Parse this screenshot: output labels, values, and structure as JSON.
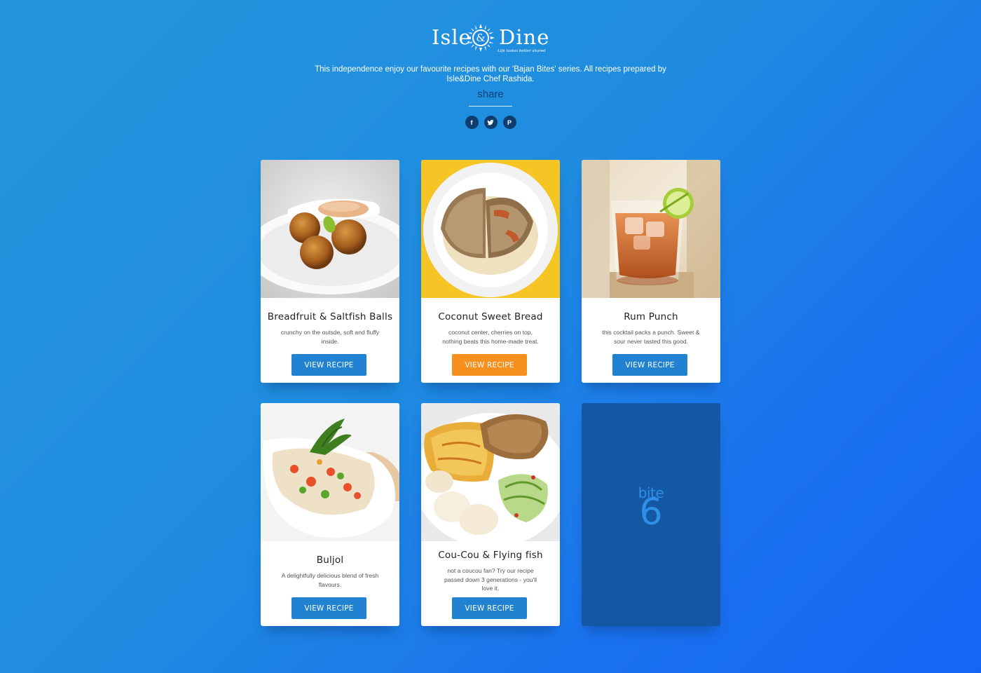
{
  "brand": {
    "name_left": "Isle",
    "name_right": "Dine",
    "ampersand": "&",
    "tagline": "Life tastes better shared"
  },
  "intro": {
    "text": "This independence enjoy our favourite recipes with our 'Bajan Bites' series. All recipes prepared by Isle&Dine Chef Rashida."
  },
  "share": {
    "label": "share",
    "buttons": [
      {
        "icon": "facebook-icon",
        "glyph": "f"
      },
      {
        "icon": "twitter-icon",
        "glyph": ""
      },
      {
        "icon": "pinterest-icon",
        "glyph": "P"
      }
    ]
  },
  "colors": {
    "button_blue": "#2182d2",
    "button_orange": "#f7901e",
    "share_text": "#0f3f78",
    "bite_card_bg": "#1457a3",
    "bite_text": "#2f8ee8"
  },
  "recipes": [
    {
      "title": "Breadfruit & Saltfish Balls",
      "description": "crunchy on the outsde, soft and fluffy inside.",
      "button": "VIEW RECIPE",
      "button_color": "#2182d2"
    },
    {
      "title": "Coconut Sweet Bread",
      "description": "coconut center, cherries on top, nothing beats this home-made treat.",
      "button": "VIEW RECIPE",
      "button_color": "#f7901e"
    },
    {
      "title": "Rum Punch",
      "description": "this cocktail packs a punch. Sweet & sour never tasted this good.",
      "button": "VIEW RECIPE",
      "button_color": "#2182d2"
    },
    {
      "title": "Buljol",
      "description": "A delightfully delicious blend of fresh flavours.",
      "button": "VIEW RECIPE",
      "button_color": "#2182d2"
    },
    {
      "title": "Cou-Cou & Flying fish",
      "description": "not a coucou fan? Try our recipe passed down 3 generations - you'll love it.",
      "button": "VIEW RECIPE",
      "button_color": "#2182d2"
    }
  ],
  "bite_card": {
    "word": "bite",
    "number": "6"
  }
}
